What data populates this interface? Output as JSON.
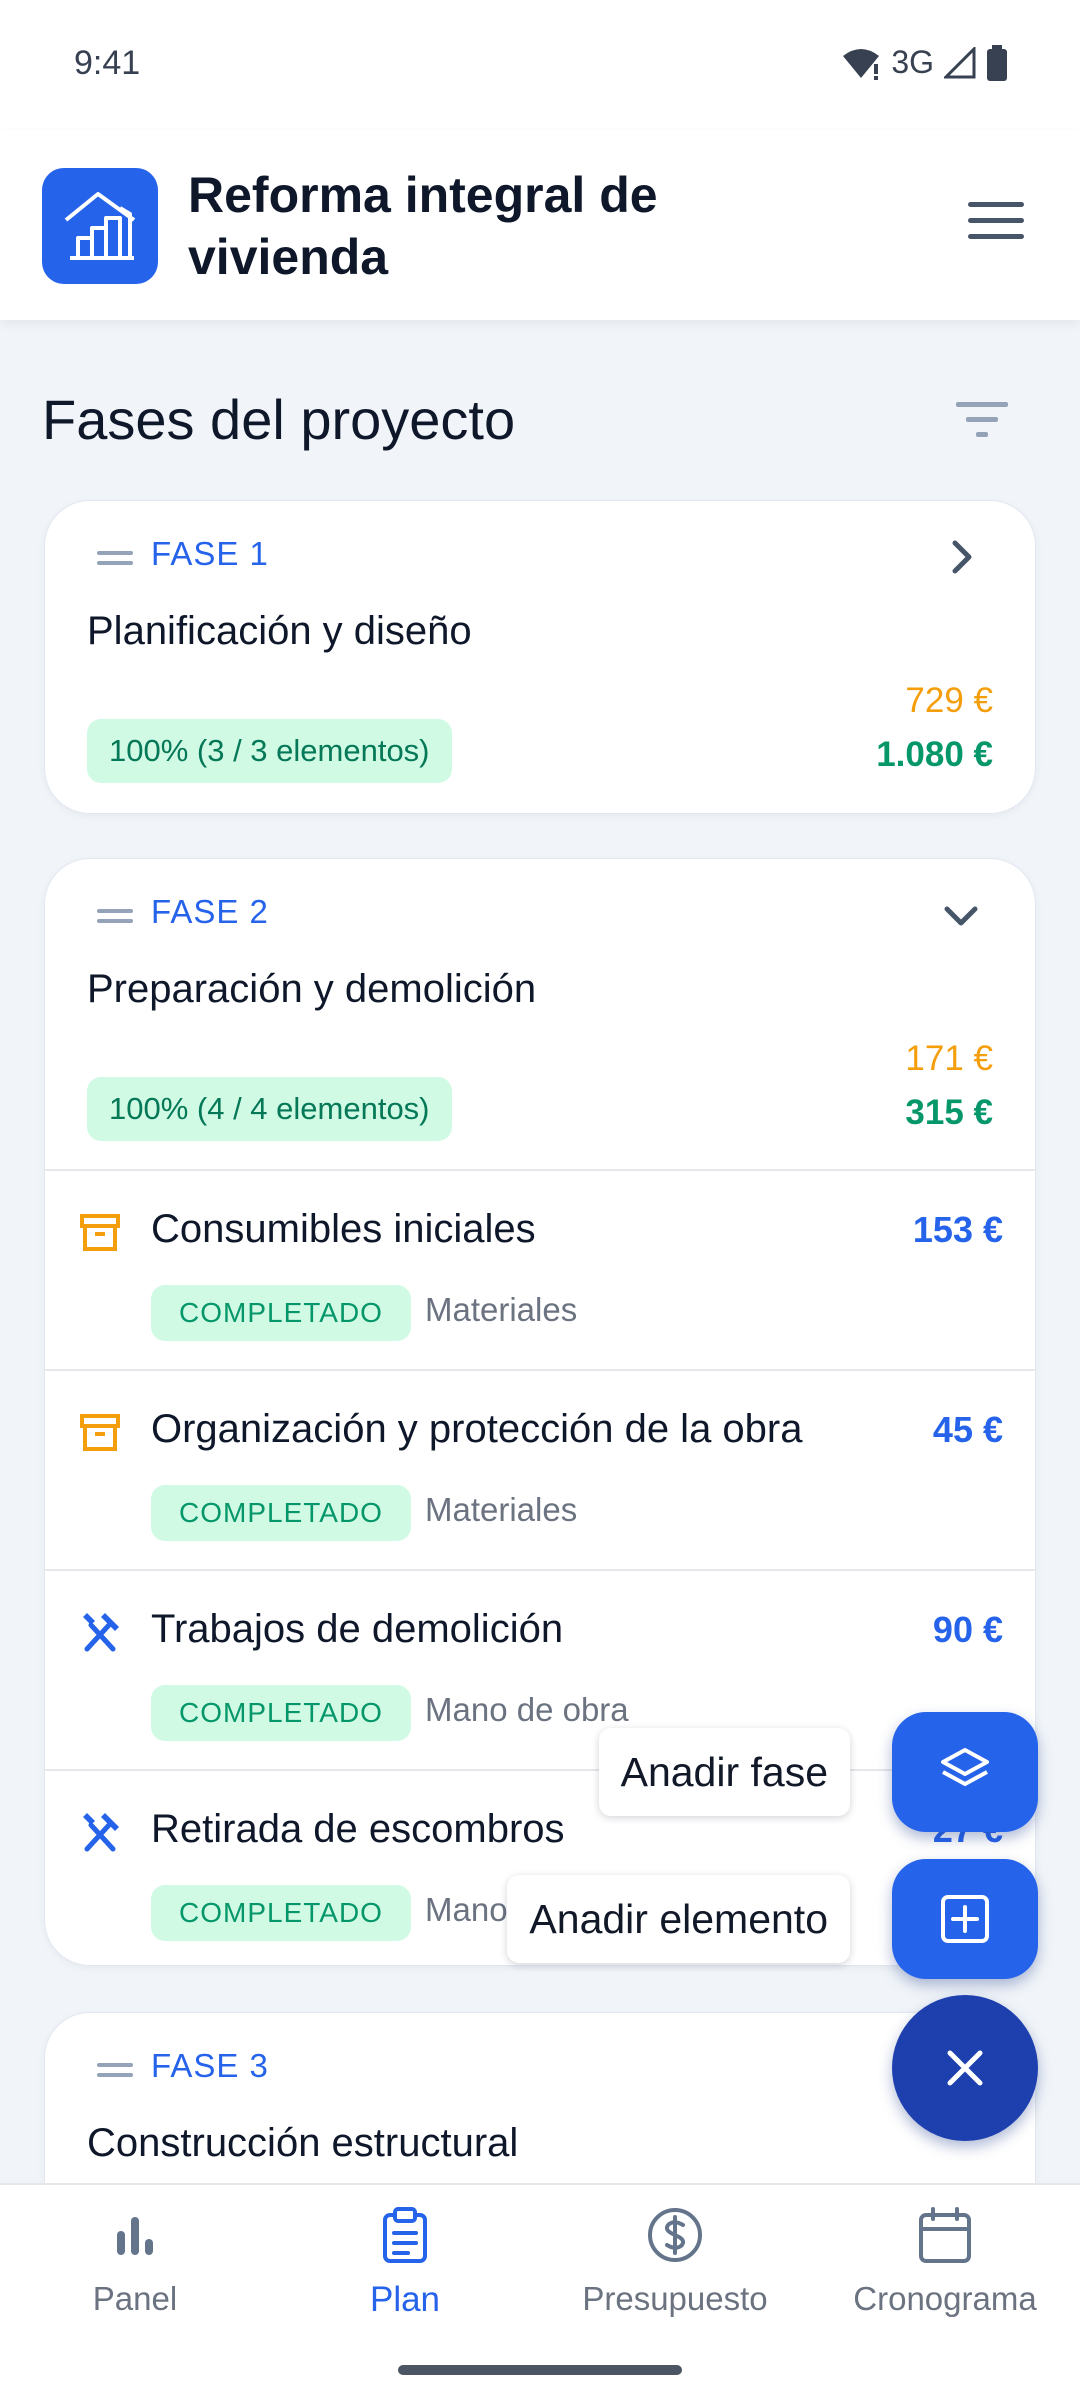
{
  "status_bar": {
    "time": "9:41",
    "network": "3G"
  },
  "app": {
    "title": "Reforma integral de vivienda"
  },
  "section": {
    "title": "Fases del proyecto"
  },
  "phases": [
    {
      "label": "FASE 1",
      "name": "Planificación y diseño",
      "progress": "100% (3 / 3 elementos)",
      "cost_actual": "729 €",
      "cost_budget": "1.080 €",
      "expanded": false
    },
    {
      "label": "FASE 2",
      "name": "Preparación y demolición",
      "progress": "100% (4 / 4 elementos)",
      "cost_actual": "171 €",
      "cost_budget": "315 €",
      "expanded": true,
      "items": [
        {
          "name": "Consumibles iniciales",
          "cost": "153 €",
          "status": "COMPLETADO",
          "category": "Materiales",
          "icon": "box-icon"
        },
        {
          "name": "Organización y protección de la obra",
          "cost": "45 €",
          "status": "COMPLETADO",
          "category": "Materiales",
          "icon": "box-icon"
        },
        {
          "name": "Trabajos de demolición",
          "cost": "90 €",
          "status": "COMPLETADO",
          "category": "Mano de obra",
          "icon": "tools-icon"
        },
        {
          "name": "Retirada de escombros",
          "cost": "27 €",
          "status": "COMPLETADO",
          "category": "Mano de obra",
          "icon": "tools-icon"
        }
      ]
    },
    {
      "label": "FASE 3",
      "name": "Construcción estructural"
    }
  ],
  "fab": {
    "add_phase": "Anadir fase",
    "add_item": "Anadir elemento"
  },
  "nav": [
    {
      "label": "Panel",
      "icon": "bar-chart-icon"
    },
    {
      "label": "Plan",
      "icon": "clipboard-icon",
      "active": true
    },
    {
      "label": "Presupuesto",
      "icon": "dollar-icon"
    },
    {
      "label": "Cronograma",
      "icon": "calendar-icon"
    }
  ]
}
